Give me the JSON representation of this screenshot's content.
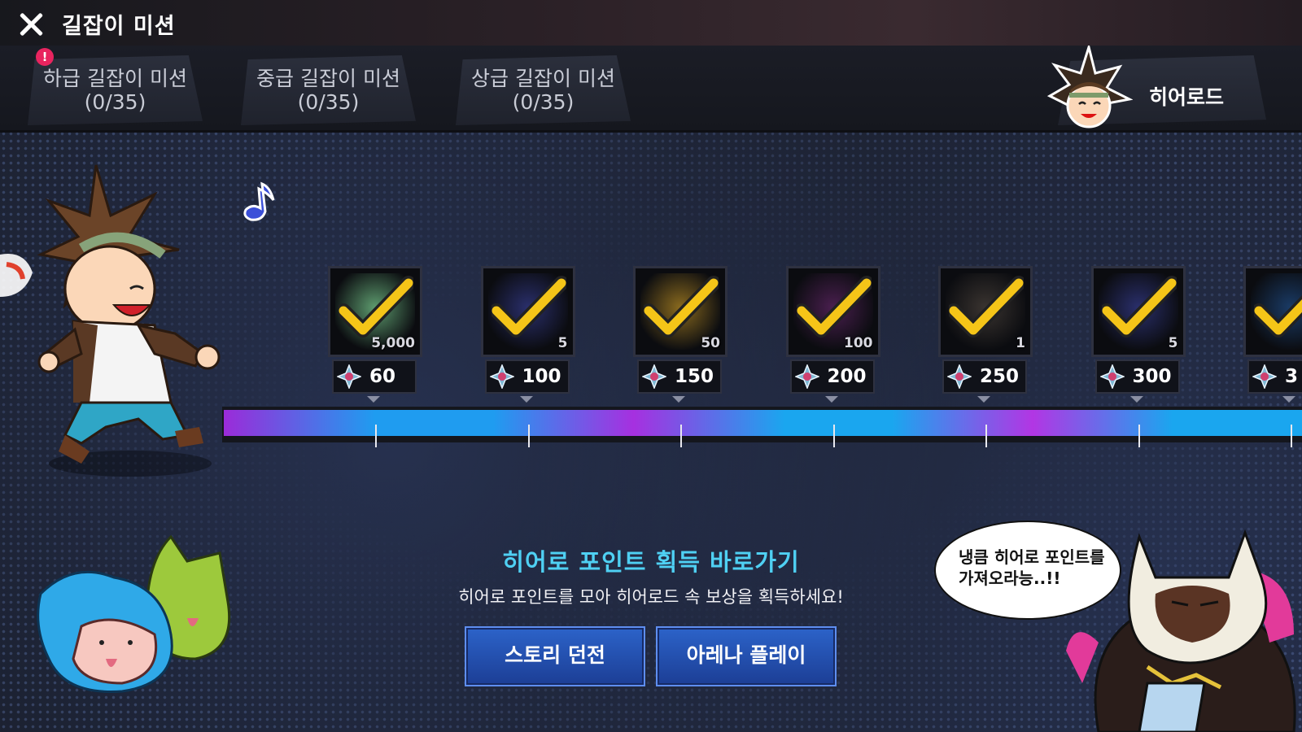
{
  "header": {
    "title": "길잡이 미션",
    "close_icon": "close-icon"
  },
  "tabs": [
    {
      "line1": "하급 길잡이 미션",
      "line2": "(0/35)",
      "alert": "!"
    },
    {
      "line1": "중급 길잡이 미션",
      "line2": "(0/35)"
    },
    {
      "line1": "상급 길잡이 미션",
      "line2": "(0/35)"
    }
  ],
  "heroroad": {
    "label": "히어로드"
  },
  "rewards": [
    {
      "points": "60",
      "qty": "5,000",
      "item": "cube-item",
      "claimed": true
    },
    {
      "points": "100",
      "qty": "5",
      "item": "dragon-emblem-item",
      "claimed": true
    },
    {
      "points": "150",
      "qty": "50",
      "item": "gold-bag-item",
      "claimed": true
    },
    {
      "points": "200",
      "qty": "100",
      "item": "purple-gem-item",
      "claimed": true
    },
    {
      "points": "250",
      "qty": "1",
      "item": "hero-portrait-item",
      "claimed": true
    },
    {
      "points": "300",
      "qty": "5",
      "item": "dragon-emblem-item",
      "claimed": true
    },
    {
      "points": "3",
      "qty": "",
      "item": "blue-crystal-item",
      "claimed": true
    }
  ],
  "shortcut": {
    "title": "히어로 포인트 획득 바로가기",
    "subtitle": "히어로 포인트를 모아 히어로드 속 보상을 획득하세요!",
    "story_button": "스토리 던전",
    "arena_button": "아레나 플레이"
  },
  "speech": {
    "line1": "냉큼 히어로 포인트를",
    "line2": "가져오라능..!!"
  },
  "colors": {
    "accent_cyan": "#4fd0f3",
    "button_blue": "#2c63c9",
    "alert_pink": "#e8245f",
    "check_yellow": "#f5c518"
  }
}
